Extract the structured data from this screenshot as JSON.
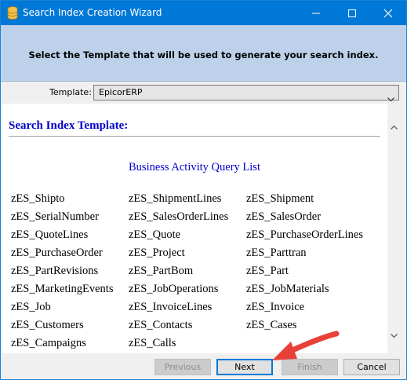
{
  "window": {
    "title": "Search Index Creation Wizard",
    "icon": "database-icon"
  },
  "header": {
    "message": "Select the Template that will be used to generate your search index."
  },
  "template": {
    "label": "Template:",
    "selected": "EpicorERP"
  },
  "content": {
    "heading": "Search Index Template:",
    "query_list_title": "Business Activity Query List",
    "queries": [
      "zES_Shipto",
      "zES_ShipmentLines",
      "zES_Shipment",
      "zES_SerialNumber",
      "zES_SalesOrderLines",
      "zES_SalesOrder",
      "zES_QuoteLines",
      "zES_Quote",
      "zES_PurchaseOrderLines",
      "zES_PurchaseOrder",
      "zES_Project",
      "zES_Parttran",
      "zES_PartRevisions",
      "zES_PartBom",
      "zES_Part",
      "zES_MarketingEvents",
      "zES_JobOperations",
      "zES_JobMaterials",
      "zES_Job",
      "zES_InvoiceLines",
      "zES_Invoice",
      "zES_Customers",
      "zES_Contacts",
      "zES_Cases",
      "zES_Campaigns",
      "zES_Calls"
    ]
  },
  "buttons": {
    "previous": "Previous",
    "next": "Next",
    "finish": "Finish",
    "cancel": "Cancel"
  },
  "colors": {
    "titlebar": "#0078d7",
    "header_panel": "#bdd2ea",
    "template_text": "#0000cc",
    "annotation_arrow": "#e8413a"
  }
}
